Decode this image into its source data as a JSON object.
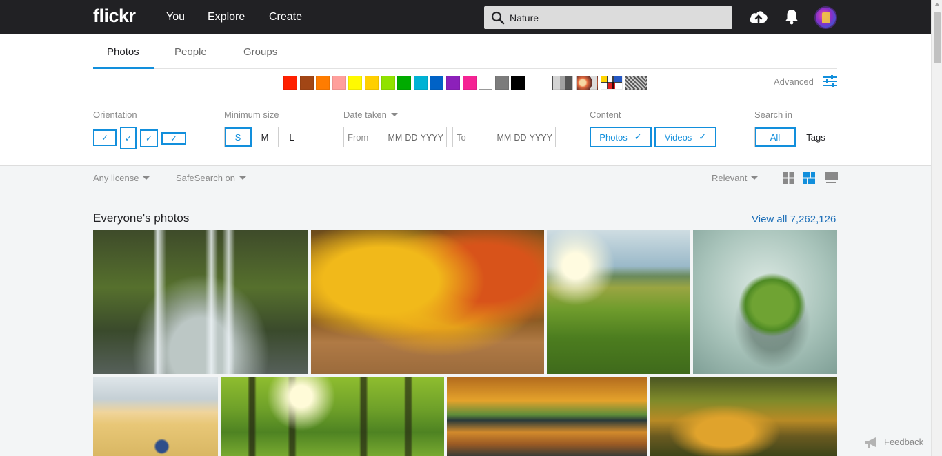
{
  "nav": {
    "logo": "flickr",
    "links": [
      "You",
      "Explore",
      "Create"
    ],
    "search_value": "Nature"
  },
  "tabs": [
    "Photos",
    "People",
    "Groups"
  ],
  "colors": [
    "#ff2000",
    "#a24615",
    "#ff7c00",
    "#ff9f9c",
    "#fffa00",
    "#ffcf00",
    "#90e200",
    "#00ab00",
    "#00b2d4",
    "#0062c6",
    "#8c20ba",
    "#f52394",
    "#ffffff",
    "#7c7c7c",
    "#000000"
  ],
  "styles": [
    "black-and-white",
    "shallow-depth-of-field",
    "minimalist",
    "patterns"
  ],
  "advanced_label": "Advanced",
  "filters": {
    "orientation_label": "Orientation",
    "min_size_label": "Minimum size",
    "sizes": [
      "S",
      "M",
      "L"
    ],
    "selected_size": "S",
    "date_taken_label": "Date taken",
    "from_label": "From",
    "to_label": "To",
    "date_placeholder": "MM-DD-YYYY",
    "content_label": "Content",
    "content_photos": "Photos",
    "content_videos": "Videos",
    "search_in_label": "Search in",
    "search_in": [
      "All",
      "Tags"
    ],
    "search_in_selected": "All"
  },
  "toolbar": {
    "license": "Any license",
    "safesearch": "SafeSearch on",
    "sort": "Relevant"
  },
  "results": {
    "title": "Everyone's photos",
    "view_all": "View all 7,262,126"
  },
  "feedback": "Feedback",
  "accent": "#128fdc",
  "link_color": "#1d6fb8"
}
